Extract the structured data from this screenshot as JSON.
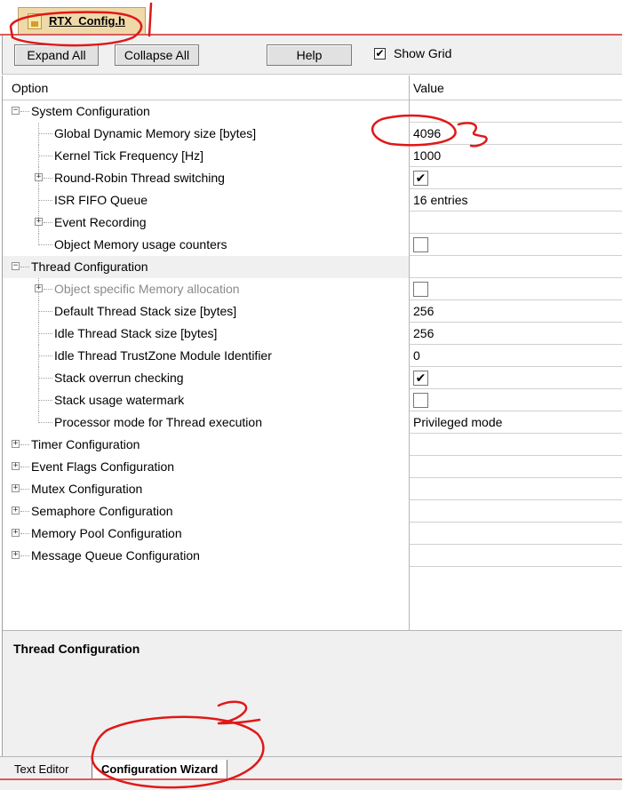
{
  "file_tab": {
    "label": "RTX_Config.h"
  },
  "toolbar": {
    "expand_all": "Expand All",
    "collapse_all": "Collapse All",
    "help": "Help",
    "show_grid_label": "Show Grid",
    "show_grid_checked": "✔"
  },
  "table": {
    "col_option": "Option",
    "col_value": "Value",
    "rows": [
      {
        "label": "System Configuration",
        "value": ""
      },
      {
        "label": "Global Dynamic Memory size [bytes]",
        "value": "4096"
      },
      {
        "label": "Kernel Tick Frequency [Hz]",
        "value": "1000"
      },
      {
        "label": "Round-Robin Thread switching",
        "value": "✔"
      },
      {
        "label": "ISR FIFO Queue",
        "value": "16 entries"
      },
      {
        "label": "Event Recording",
        "value": ""
      },
      {
        "label": "Object Memory usage counters",
        "value": ""
      },
      {
        "label": "Thread Configuration",
        "value": ""
      },
      {
        "label": "Object specific Memory allocation",
        "value": ""
      },
      {
        "label": "Default Thread Stack size [bytes]",
        "value": "256"
      },
      {
        "label": "Idle Thread Stack size [bytes]",
        "value": "256"
      },
      {
        "label": "Idle Thread TrustZone Module Identifier",
        "value": "0"
      },
      {
        "label": "Stack overrun checking",
        "value": "✔"
      },
      {
        "label": "Stack usage watermark",
        "value": ""
      },
      {
        "label": "Processor mode for Thread execution",
        "value": "Privileged mode"
      },
      {
        "label": "Timer Configuration",
        "value": ""
      },
      {
        "label": "Event Flags Configuration",
        "value": ""
      },
      {
        "label": "Mutex Configuration",
        "value": ""
      },
      {
        "label": "Semaphore Configuration",
        "value": ""
      },
      {
        "label": "Memory Pool Configuration",
        "value": ""
      },
      {
        "label": "Message Queue Configuration",
        "value": ""
      }
    ]
  },
  "description": {
    "title": "Thread Configuration"
  },
  "bottom_tabs": {
    "text_editor": "Text Editor",
    "config_wizard": "Configuration Wizard"
  },
  "tree_glyphs": {
    "expanded": "−",
    "collapsed": "+"
  },
  "colors": {
    "annotation": "#e01818",
    "selected_row": "#f0f0f0",
    "disabled_text": "#8a8a8a"
  }
}
